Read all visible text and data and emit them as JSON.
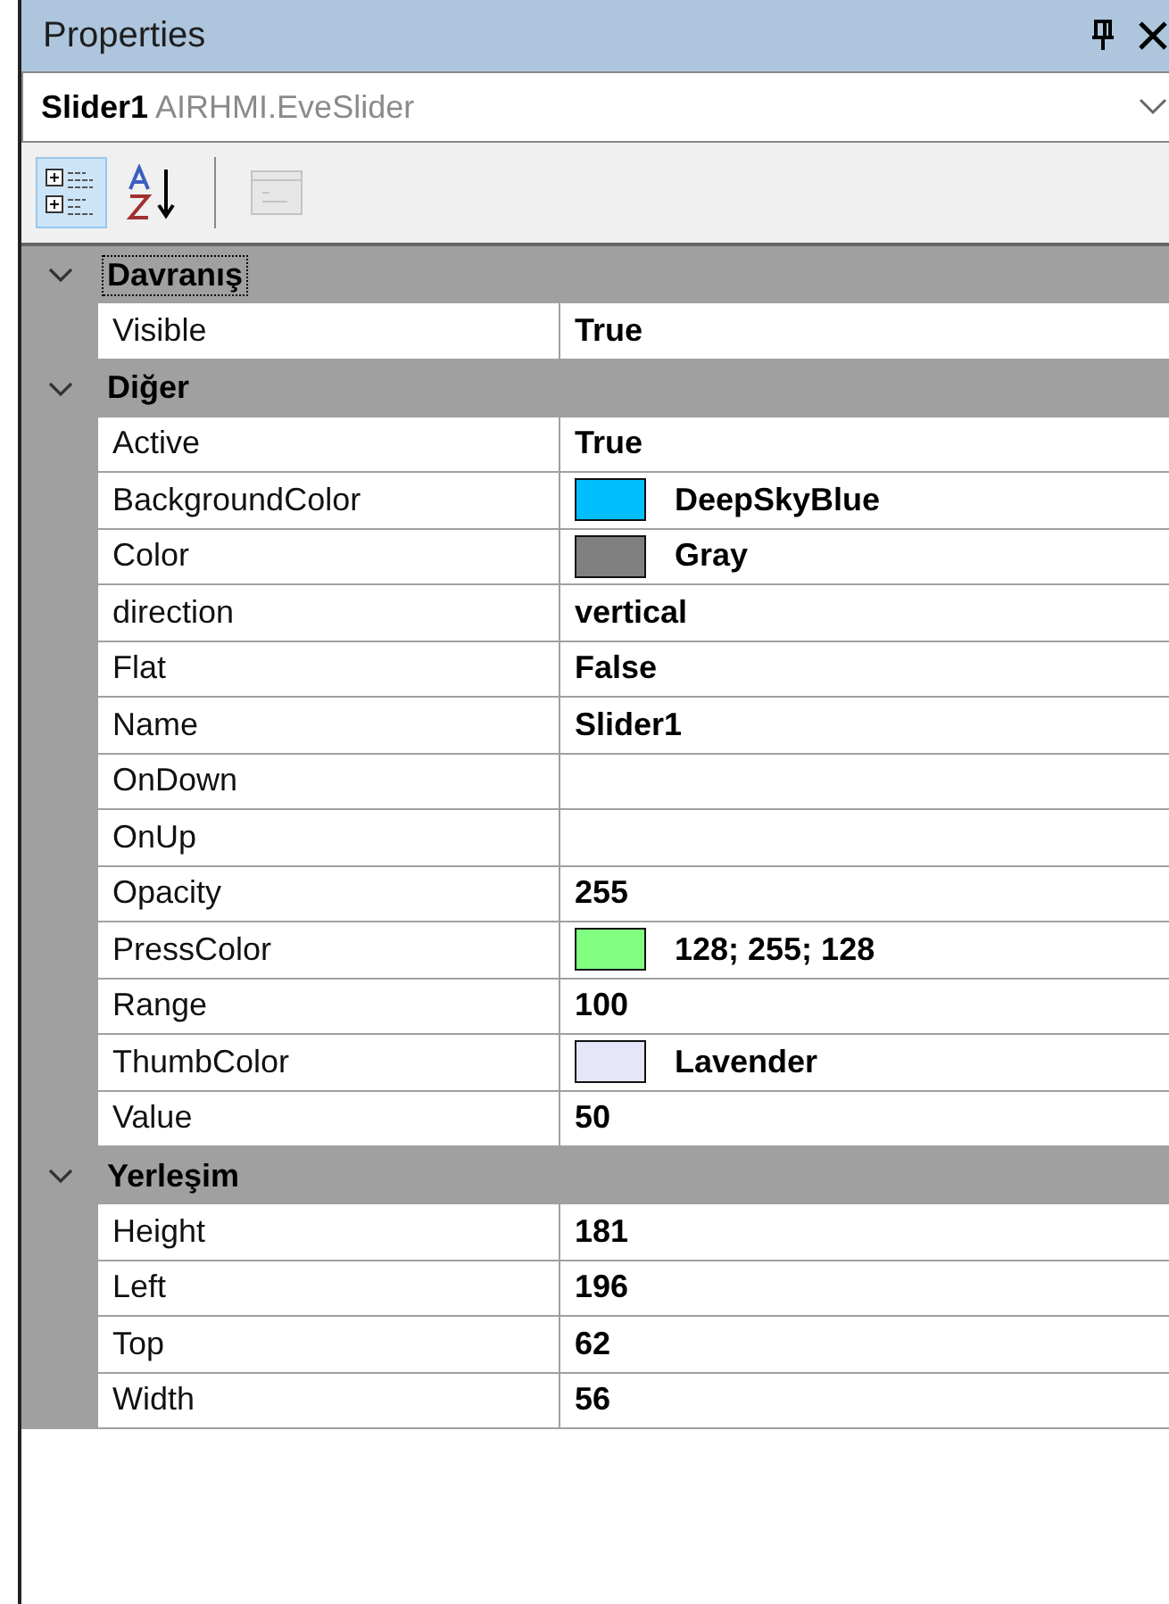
{
  "window": {
    "title": "Properties"
  },
  "object_selector": {
    "name": "Slider1",
    "type": "AIRHMI.EveSlider"
  },
  "toolbar": [
    {
      "kind": "categorized",
      "selected": true,
      "disabled": false
    },
    {
      "kind": "alphabetical",
      "selected": false,
      "disabled": false
    },
    {
      "kind": "property-pages",
      "selected": false,
      "disabled": true
    }
  ],
  "categories": [
    {
      "name": "Davranış",
      "expanded": true,
      "selected": true,
      "properties": [
        {
          "name": "Visible",
          "value": "True"
        }
      ]
    },
    {
      "name": "Diğer",
      "expanded": true,
      "selected": false,
      "properties": [
        {
          "name": "Active",
          "value": "True"
        },
        {
          "name": "BackgroundColor",
          "value": "DeepSkyBlue",
          "color": "#00bfff"
        },
        {
          "name": "Color",
          "value": "Gray",
          "color": "#808080"
        },
        {
          "name": "direction",
          "value": "vertical"
        },
        {
          "name": "Flat",
          "value": "False"
        },
        {
          "name": "Name",
          "value": "Slider1"
        },
        {
          "name": "OnDown"
        },
        {
          "name": "OnUp"
        },
        {
          "name": "Opacity",
          "value": "255"
        },
        {
          "name": "PressColor",
          "value": "128; 255; 128",
          "color": "#80ff80"
        },
        {
          "name": "Range",
          "value": "100"
        },
        {
          "name": "ThumbColor",
          "value": "Lavender",
          "color": "#e6e6fa"
        },
        {
          "name": "Value",
          "value": "50"
        }
      ]
    },
    {
      "name": "Yerleşim",
      "expanded": true,
      "selected": false,
      "properties": [
        {
          "name": "Height",
          "value": "181"
        },
        {
          "name": "Left",
          "value": "196"
        },
        {
          "name": "Top",
          "value": "62"
        },
        {
          "name": "Width",
          "value": "56"
        }
      ]
    }
  ]
}
